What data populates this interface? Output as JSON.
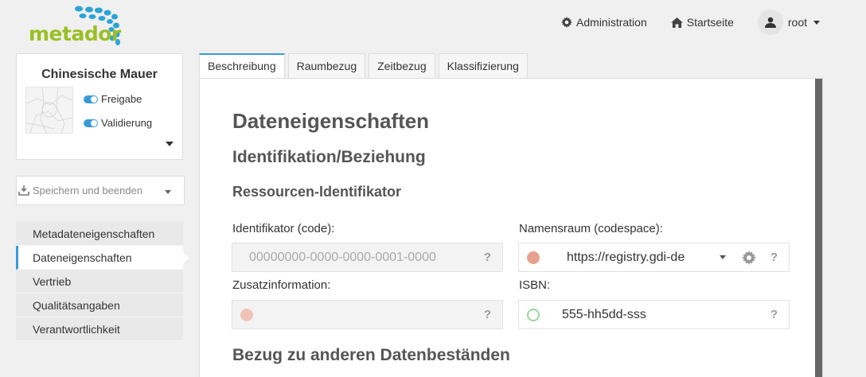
{
  "brand": {
    "logo_text": "metador",
    "logo_color": "#9bbf24",
    "dots_color": "#2aa3d8"
  },
  "topnav": {
    "admin_label": "Administration",
    "home_label": "Startseite",
    "user_label": "root"
  },
  "record": {
    "title": "Chinesische Mauer",
    "toggle_release": "Freigabe",
    "toggle_validation": "Validierung"
  },
  "save_button": {
    "label": "Speichern und beenden"
  },
  "sidenav": {
    "items": [
      {
        "label": "Metadateneigenschaften"
      },
      {
        "label": "Dateneigenschaften"
      },
      {
        "label": "Vertrieb"
      },
      {
        "label": "Qualitätsangaben"
      },
      {
        "label": "Verantwortlichkeit"
      }
    ],
    "active_index": 1
  },
  "tabs": [
    {
      "label": "Beschreibung"
    },
    {
      "label": "Raumbezug"
    },
    {
      "label": "Zeitbezug"
    },
    {
      "label": "Klassifizierung"
    }
  ],
  "content": {
    "heading": "Dateneigenschaften",
    "section": "Identifikation/Beziehung",
    "subsection": "Ressourcen-Identifikator",
    "identifier_label": "Identifikator (code):",
    "identifier_value": "00000000-0000-0000-0001-0000",
    "namespace_label": "Namensraum (codespace):",
    "namespace_value": "https://registry.gdi-de",
    "additional_label": "Zusatzinformation:",
    "additional_value": "",
    "isbn_label": "ISBN:",
    "isbn_value": "555-hh5dd-sss",
    "help_glyph": "?",
    "next_section": "Bezug zu anderen Datenbeständen"
  },
  "colors": {
    "accent": "#3a9ad9",
    "invalid": "#e8a08f",
    "valid": "#9bd79b"
  }
}
